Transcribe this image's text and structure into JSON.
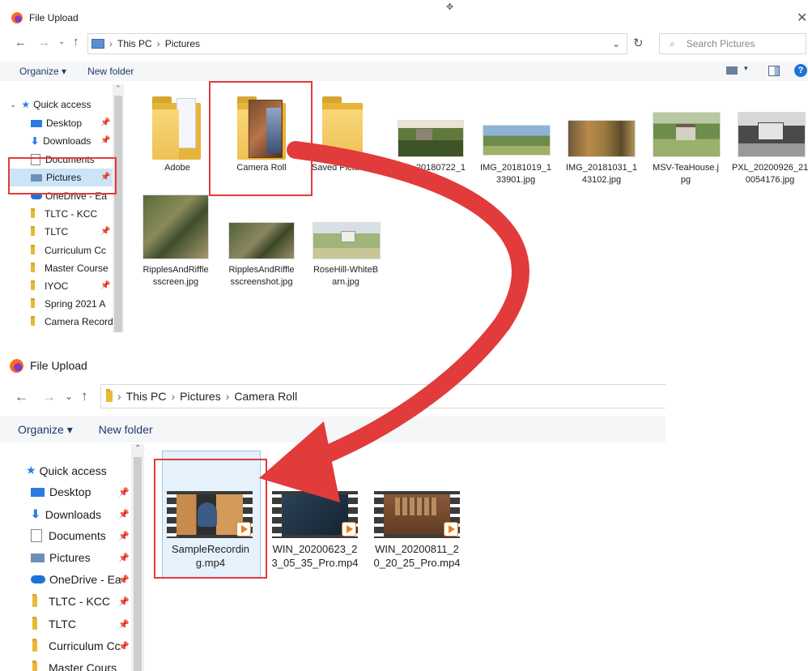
{
  "top": {
    "title": "File Upload",
    "breadcrumb": [
      "This PC",
      "Pictures"
    ],
    "search_placeholder": "Search Pictures",
    "toolbar": {
      "organize": "Organize",
      "new_folder": "New folder"
    },
    "nav_items": [
      "Quick access",
      "Desktop",
      "Downloads",
      "Documents",
      "Pictures",
      "OneDrive - Ea",
      "TLTC - KCC",
      "TLTC",
      "Curriculum Cc",
      "Master Course",
      "IYOC",
      "Spring 2021 A",
      "Camera Recordir"
    ],
    "items": [
      {
        "name": "Adobe",
        "kind": "folder"
      },
      {
        "name": "Camera Roll",
        "kind": "folder"
      },
      {
        "name": "Saved Pictu",
        "kind": "folder"
      },
      {
        "name": "IMG_20180722_1",
        "kind": "photo"
      },
      {
        "name": "IMG_20181019_1 33901.jpg",
        "kind": "photo"
      },
      {
        "name": "IMG_20181031_1 43102.jpg",
        "kind": "photo"
      },
      {
        "name": "MSV-TeaHouse.j pg",
        "kind": "photo"
      },
      {
        "name": "PXL_20200926_21 0054176.jpg",
        "kind": "photo"
      },
      {
        "name": "RipplesAndRiffle sscreen.jpg",
        "kind": "photo"
      },
      {
        "name": "RipplesAndRiffle sscreenshot.jpg",
        "kind": "photo"
      },
      {
        "name": "RoseHill-WhiteB arn.jpg",
        "kind": "photo"
      }
    ]
  },
  "bottom": {
    "title": "File Upload",
    "breadcrumb": [
      "This PC",
      "Pictures",
      "Camera Roll"
    ],
    "toolbar": {
      "organize": "Organize",
      "new_folder": "New folder"
    },
    "nav_items": [
      "Quick access",
      "Desktop",
      "Downloads",
      "Documents",
      "Pictures",
      "OneDrive - Ea",
      "TLTC - KCC",
      "TLTC",
      "Curriculum Cc",
      "Master Cours"
    ],
    "videos": [
      {
        "name": "SampleRecordin g.mp4"
      },
      {
        "name": "WIN_20200623_2 3_05_35_Pro.mp4"
      },
      {
        "name": "WIN_20200811_2 0_20_25_Pro.mp4"
      }
    ]
  },
  "colors": {
    "highlight": "#e23b3b",
    "accent": "#1e73d8",
    "folder": "#e9b838"
  }
}
